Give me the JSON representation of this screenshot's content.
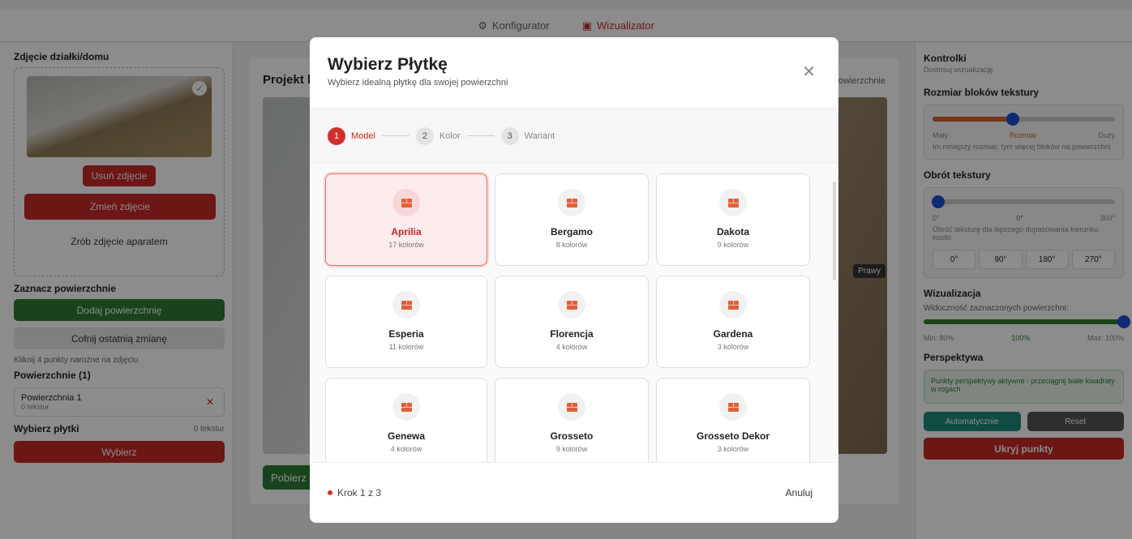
{
  "topbar": {
    "tabs": [
      {
        "label": "Konfigurator",
        "icon": "gear-icon"
      },
      {
        "label": "Wizualizator",
        "icon": "camera-icon",
        "active": true
      }
    ]
  },
  "left": {
    "photo_title": "Zdjęcie działki/domu",
    "remove_photo": "Usuń zdjęcie",
    "change_photo": "Zmień zdjęcie",
    "take_photo": "Zrób zdjęcie aparatem",
    "mark_title": "Zaznacz powierzchnie",
    "add_surface": "Dodaj powierzchnię",
    "undo": "Cofnij ostatnią zmianę",
    "hint": "Kliknij 4 punkty narożne na zdjęciu",
    "surfaces_title": "Powierzchnie (1)",
    "surface_name": "Powierzchnia 1",
    "surface_textures": "0 tekstur",
    "choose_tiles": "Wybierz płytki",
    "tiles_count": "0 tekstur",
    "choose_btn": "Wybierz"
  },
  "center": {
    "title": "Projekt ko",
    "hint": "owierzchnie",
    "prawy": "Prawy",
    "download": "Pobierz"
  },
  "right": {
    "title": "Kontrolki",
    "subtitle": "Dostosuj wizualizację",
    "size_title": "Rozmiar bloków tekstury",
    "size_min": "Mały",
    "size_mid": "Rozmiar",
    "size_max": "Duży",
    "size_note": "Im mniejszy rozmiar, tym więcej bloków na powierzchni",
    "size_value": 0.44,
    "rot_title": "Obrót tekstury",
    "rot_min": "0°",
    "rot_val": "0°",
    "rot_max": "360°",
    "rot_note": "Obróć teksturę dla lepszego dopasowania kierunku kostki",
    "rot_buttons": [
      "0°",
      "90°",
      "180°",
      "270°"
    ],
    "viz_title": "Wizualizacja",
    "visibility_label": "Widoczność zaznaczonych powierzchni:",
    "vis_min": "Min: 80%",
    "vis_val": "100%",
    "vis_max": "Max: 100%",
    "persp_title": "Perspektywa",
    "persp_note": "Punkty perspektywy aktywne - przeciągnij białe kwadraty w rogach",
    "auto_btn": "Automatycznie",
    "reset_btn": "Reset",
    "hide_points": "Ukryj punkty"
  },
  "modal": {
    "title": "Wybierz Płytkę",
    "subtitle": "Wybierz idealną płytkę dla swojej powierzchni",
    "steps": [
      {
        "num": "1",
        "label": "Model"
      },
      {
        "num": "2",
        "label": "Kolor"
      },
      {
        "num": "3",
        "label": "Wariant"
      }
    ],
    "tiles": [
      {
        "name": "Aprilia",
        "count": "17 kolorów"
      },
      {
        "name": "Bergamo",
        "count": "8 kolorów"
      },
      {
        "name": "Dakota",
        "count": "9 kolorów"
      },
      {
        "name": "Esperia",
        "count": "11 kolorów"
      },
      {
        "name": "Florencja",
        "count": "4 kolorów"
      },
      {
        "name": "Gardena",
        "count": "3 kolorów"
      },
      {
        "name": "Genewa",
        "count": "4 kolorów"
      },
      {
        "name": "Grosseto",
        "count": "9 kolorów"
      },
      {
        "name": "Grosseto Dekor",
        "count": "3 kolorów"
      }
    ],
    "footer_step": "Krok 1 z 3",
    "cancel": "Anuluj"
  },
  "colors": {
    "accent_red": "#c62828",
    "green": "#2e7d32",
    "blue": "#1e4fd6"
  }
}
